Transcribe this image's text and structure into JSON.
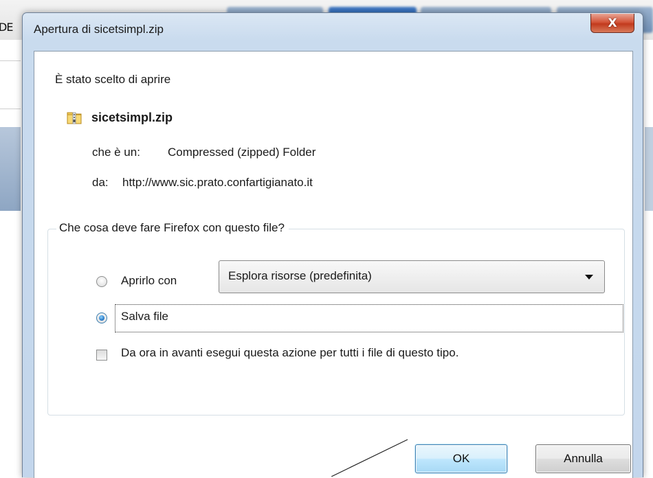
{
  "background": {
    "left_text": "DE"
  },
  "dialog": {
    "title": "Apertura di sicetsimpl.zip",
    "close_label": "X",
    "intro": "È stato scelto di aprire",
    "filename": "sicetsimpl.zip",
    "type_label": "che è un:",
    "type_value": "Compressed (zipped) Folder",
    "from_label": "da:",
    "from_value": "http://www.sic.prato.confartigianato.it",
    "question": "Che cosa deve fare Firefox con questo file?",
    "open_with_label": "Aprirlo con",
    "open_with_selected": "Esplora risorse (predefinita)",
    "save_label": "Salva file",
    "remember_label": "Da ora in avanti esegui questa azione per tutti i file di questo tipo.",
    "ok_label": "OK",
    "cancel_label": "Annulla",
    "selected_option": "Salva file",
    "remember_checked": false
  },
  "icons": {
    "zip": "zip-folder-icon",
    "close": "close-icon",
    "dropdown": "chevron-down-icon"
  },
  "colors": {
    "close_button": "#c23a1e",
    "ok_button_border": "#3c7fb1",
    "titlebar": "#c9dbee"
  }
}
